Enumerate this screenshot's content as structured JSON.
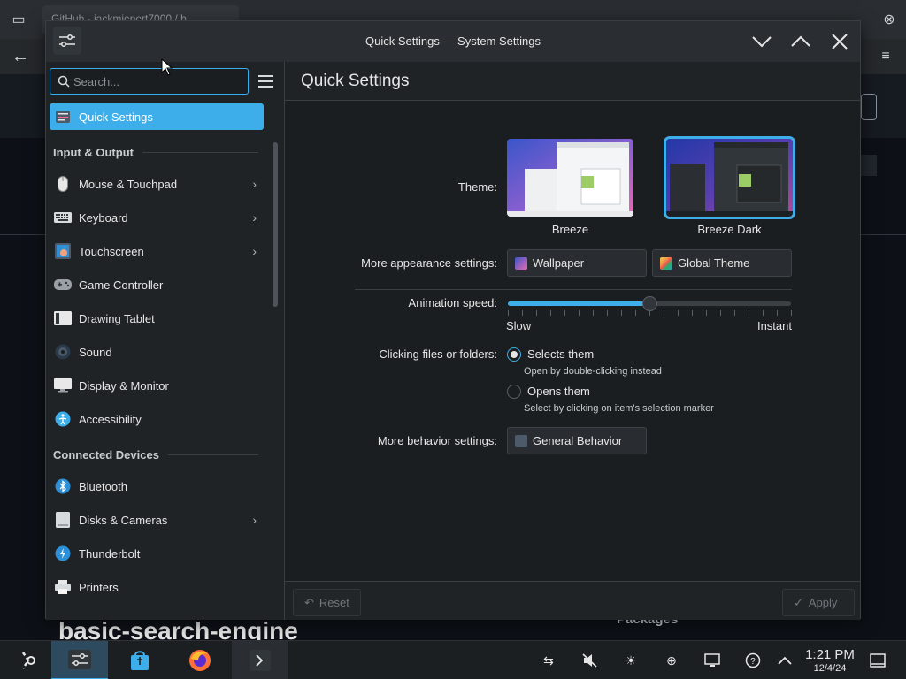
{
  "background_browser": {
    "tab_title": "GitHub - jackmienert7000 / b...",
    "repo_heading": "basic-search-engine",
    "packages_label": "Packages"
  },
  "window": {
    "title": "Quick Settings — System Settings"
  },
  "sidebar": {
    "search_placeholder": "Search...",
    "groups": [
      {
        "header": "",
        "items": [
          {
            "label": "Quick Settings",
            "icon": "quick-settings-icon",
            "active": true,
            "has_arrow": false
          }
        ]
      },
      {
        "header": "Input & Output",
        "items": [
          {
            "label": "Mouse & Touchpad",
            "icon": "mouse-icon",
            "has_arrow": true
          },
          {
            "label": "Keyboard",
            "icon": "keyboard-icon",
            "has_arrow": true
          },
          {
            "label": "Touchscreen",
            "icon": "touchscreen-icon",
            "has_arrow": true
          },
          {
            "label": "Game Controller",
            "icon": "gamepad-icon",
            "has_arrow": false
          },
          {
            "label": "Drawing Tablet",
            "icon": "tablet-icon",
            "has_arrow": false
          },
          {
            "label": "Sound",
            "icon": "sound-icon",
            "has_arrow": false
          },
          {
            "label": "Display & Monitor",
            "icon": "monitor-icon",
            "has_arrow": false
          },
          {
            "label": "Accessibility",
            "icon": "accessibility-icon",
            "has_arrow": false
          }
        ]
      },
      {
        "header": "Connected Devices",
        "items": [
          {
            "label": "Bluetooth",
            "icon": "bluetooth-icon",
            "has_arrow": false
          },
          {
            "label": "Disks & Cameras",
            "icon": "disk-icon",
            "has_arrow": true
          },
          {
            "label": "Thunderbolt",
            "icon": "thunderbolt-icon",
            "has_arrow": false
          },
          {
            "label": "Printers",
            "icon": "printer-icon",
            "has_arrow": false
          }
        ]
      }
    ]
  },
  "content": {
    "page_title": "Quick Settings",
    "theme_label": "Theme:",
    "themes": [
      {
        "name": "Breeze",
        "selected": false
      },
      {
        "name": "Breeze Dark",
        "selected": true
      }
    ],
    "more_appearance_label": "More appearance settings:",
    "wallpaper_button": "Wallpaper",
    "global_theme_button": "Global Theme",
    "animation_speed_label": "Animation speed:",
    "animation_speed_value": 0.5,
    "slider_min_label": "Slow",
    "slider_max_label": "Instant",
    "clicking_label": "Clicking files or folders:",
    "radio_options": [
      {
        "label": "Selects them",
        "hint": "Open by double-clicking instead",
        "checked": true
      },
      {
        "label": "Opens them",
        "hint": "Select by clicking on item's selection marker",
        "checked": false
      }
    ],
    "more_behavior_label": "More behavior settings:",
    "general_behavior_button": "General Behavior",
    "reset_button": "Reset",
    "apply_button": "Apply"
  },
  "taskbar": {
    "time": "1:21 PM",
    "date": "12/4/24"
  },
  "colors": {
    "accent": "#3daee9",
    "window_bg": "#202326",
    "content_bg": "#1b1e20"
  }
}
